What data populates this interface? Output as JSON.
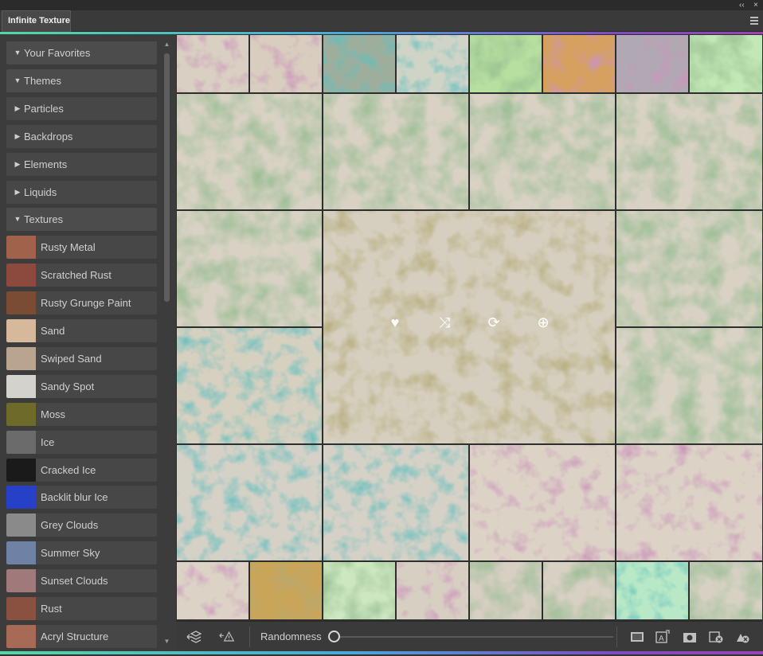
{
  "window": {
    "tab_title": "Infinite Texture",
    "collapse_glyph": "‹‹",
    "close_glyph": "×"
  },
  "colors": {
    "accent_start": "#54d6a6",
    "accent_end": "#9a45b3",
    "panel_bg": "#3c3c3c"
  },
  "sidebar": {
    "categories": [
      {
        "label": "Your Favorites",
        "expanded": true
      },
      {
        "label": "Themes",
        "expanded": true
      },
      {
        "label": "Particles",
        "expanded": false
      },
      {
        "label": "Backdrops",
        "expanded": false
      },
      {
        "label": "Elements",
        "expanded": false
      },
      {
        "label": "Liquids",
        "expanded": false
      },
      {
        "label": "Textures",
        "expanded": true
      }
    ],
    "textures": [
      {
        "label": "Rusty Metal",
        "swatch": "#a0624a"
      },
      {
        "label": "Scratched Rust",
        "swatch": "#8c4a3e"
      },
      {
        "label": "Rusty Grunge Paint",
        "swatch": "#7a4c34"
      },
      {
        "label": "Sand",
        "swatch": "#d6b99a"
      },
      {
        "label": "Swiped Sand",
        "swatch": "#b9a58f"
      },
      {
        "label": "Sandy Spot",
        "swatch": "#d4d2cc"
      },
      {
        "label": "Moss",
        "swatch": "#6e6a2a"
      },
      {
        "label": "Ice",
        "swatch": "#6b6b6b"
      },
      {
        "label": "Cracked Ice",
        "swatch": "#1a1a1a"
      },
      {
        "label": "Backlit blur Ice",
        "swatch": "#2740c8"
      },
      {
        "label": "Grey Clouds",
        "swatch": "#8a8a8a"
      },
      {
        "label": "Summer Sky",
        "swatch": "#6f82a6"
      },
      {
        "label": "Sunset Clouds",
        "swatch": "#a07a7a"
      },
      {
        "label": "Rust",
        "swatch": "#8a5040"
      },
      {
        "label": "Acryl Structure",
        "swatch": "#a66a55"
      }
    ]
  },
  "preview_actions": [
    {
      "name": "favorite-icon",
      "glyph": "♥"
    },
    {
      "name": "shuffle-icon",
      "glyph": "⤨"
    },
    {
      "name": "refresh-icon",
      "glyph": "⟳"
    },
    {
      "name": "add-icon",
      "glyph": "⊕"
    }
  ],
  "bottom_bar": {
    "randomness_label": "Randomness",
    "randomness_value": 0.0
  }
}
